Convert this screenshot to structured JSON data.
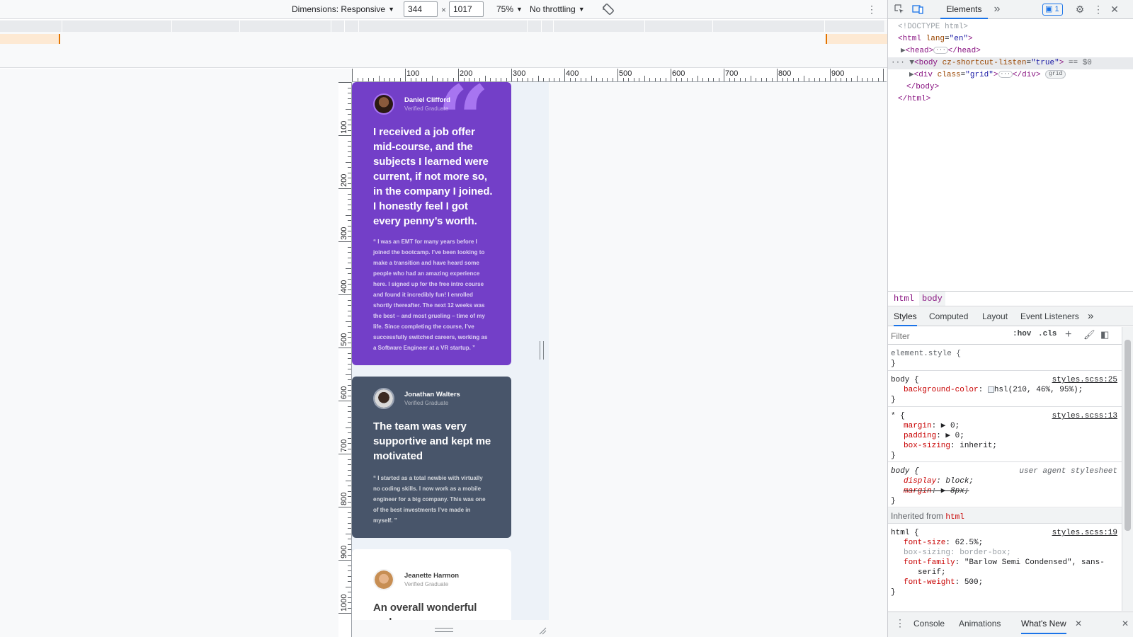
{
  "toolbar": {
    "dimensions_label": "Dimensions: Responsive",
    "width": "344",
    "height": "1017",
    "zoom": "75%",
    "throttling": "No throttling",
    "times": "×"
  },
  "ruler": {
    "top_labels": [
      "100",
      "200",
      "300",
      "400",
      "500",
      "600",
      "700",
      "800",
      "900"
    ],
    "left_labels": [
      "100",
      "200",
      "300",
      "400",
      "500",
      "600",
      "700",
      "800",
      "900",
      "1000"
    ]
  },
  "page": {
    "background": "#edf2f8",
    "cards": [
      {
        "name": "Daniel Clifford",
        "role": "Verified Graduate",
        "headline": "I received a job offer mid-course, and the subjects I learned were current, if not more so, in the company I joined. I honestly feel I got every penny’s worth.",
        "quote": "“ I was an EMT for many years before I joined the bootcamp. I’ve been looking to make a transition and have heard some people who had an amazing experience here. I signed up for the free intro course and found it incredibly fun! I enrolled shortly thereafter. The next 12 weeks was the best – and most grueling – time of my life. Since completing the course, I’ve successfully switched careers, working as a Software Engineer at a VR startup. ”",
        "color": "#733fc8"
      },
      {
        "name": "Jonathan Walters",
        "role": "Verified Graduate",
        "headline": "The team was very supportive and kept me motivated",
        "quote": "“ I started as a total newbie with virtually no coding skills. I now work as a mobile engineer for a big company. This was one of the best investments I’ve made in myself. ”",
        "color": "#48556a"
      },
      {
        "name": "Jeanette Harmon",
        "role": "Verified Graduate",
        "headline": "An overall wonderful and",
        "color": "#ffffff"
      }
    ]
  },
  "devtools": {
    "tabs": {
      "elements": "Elements",
      "more": "»",
      "issues_count": "1"
    },
    "dom": {
      "doctype": "<!DOCTYPE html>",
      "html_open_tag": "html",
      "html_attr_name": "lang",
      "html_attr_value": "\"en\"",
      "head": "head",
      "body_tag": "body",
      "body_attr_name": "cz-shortcut-listen",
      "body_attr_value": "\"true\"",
      "body_eq": "== $0",
      "div_tag": "div",
      "div_attr_name": "class",
      "div_attr_value": "\"grid\"",
      "grid_badge": "grid",
      "body_close": "</body>",
      "html_close": "</html>"
    },
    "breadcrumbs": [
      "html",
      "body"
    ],
    "styles_tabs": [
      "Styles",
      "Computed",
      "Layout",
      "Event Listeners",
      "»"
    ],
    "filter_placeholder": "Filter",
    "hov": ":hov",
    "cls": ".cls",
    "rules": {
      "element_style": "element.style {",
      "close": "}",
      "body_selector": "body {",
      "body_source": "styles.scss:25",
      "bg_prop": "background-color",
      "bg_val": "hsl(210, 46%, 95%);",
      "star_selector": "* {",
      "star_source": "styles.scss:13",
      "margin_prop": "margin",
      "margin_val": "0;",
      "padding_prop": "padding",
      "padding_val": "0;",
      "boxsizing_prop": "box-sizing",
      "boxsizing_val": "inherit;",
      "ua_selector": "body {",
      "ua_source": "user agent stylesheet",
      "display_prop": "display",
      "display_val": "block;",
      "ua_margin_prop": "margin",
      "ua_margin_val": "8px;",
      "inherited_label": "Inherited from",
      "inherited_tag": "html",
      "html_selector": "html {",
      "html_source": "styles.scss:19",
      "fontsize_prop": "font-size",
      "fontsize_val": "62.5%;",
      "bs_prop": "box-sizing",
      "bs_val": "border-box;",
      "fontfamily_prop": "font-family",
      "fontfamily_val": "\"Barlow Semi Condensed\", sans-",
      "fontfamily_val2": "serif;",
      "fontweight_prop": "font-weight",
      "fontweight_val": "500;"
    },
    "drawer": [
      "Console",
      "Animations",
      "What's New"
    ],
    "accent": "#1a73e8"
  }
}
